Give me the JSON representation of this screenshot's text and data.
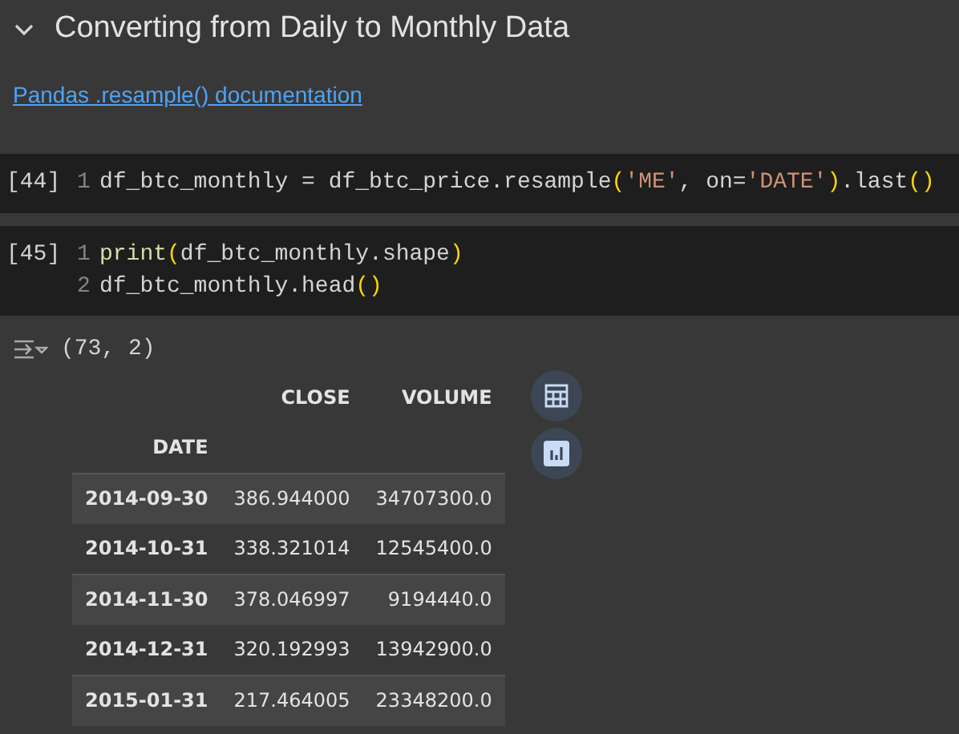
{
  "section": {
    "title": "Converting from Daily to Monthly Data",
    "expanded": true
  },
  "link": "Pandas .resample() documentation",
  "cells": [
    {
      "count": "[44]",
      "lines": [
        {
          "number": "1",
          "tokens": [
            {
              "kind": "plain",
              "text": "df_btc_monthly = df_btc_price.resample"
            },
            {
              "kind": "bracket",
              "text": "("
            },
            {
              "kind": "string",
              "text": "'ME'"
            },
            {
              "kind": "plain",
              "text": ", on="
            },
            {
              "kind": "string",
              "text": "'DATE'"
            },
            {
              "kind": "bracket",
              "text": ")"
            },
            {
              "kind": "plain",
              "text": ".last"
            },
            {
              "kind": "bracket",
              "text": "()"
            }
          ]
        }
      ]
    },
    {
      "count": "[45]",
      "lines": [
        {
          "number": "1",
          "tokens": [
            {
              "kind": "builtin",
              "text": "print"
            },
            {
              "kind": "bracket",
              "text": "("
            },
            {
              "kind": "plain",
              "text": "df_btc_monthly.shape"
            },
            {
              "kind": "bracket",
              "text": ")"
            }
          ]
        },
        {
          "number": "2",
          "tokens": [
            {
              "kind": "plain",
              "text": "df_btc_monthly.head"
            },
            {
              "kind": "bracket",
              "text": "()"
            }
          ]
        }
      ]
    }
  ],
  "output": {
    "shape": "(73, 2)",
    "table": {
      "columns": [
        "",
        "CLOSE",
        "VOLUME"
      ],
      "index_name": "DATE",
      "rows": [
        [
          "2014-09-30",
          "386.944000",
          "34707300.0"
        ],
        [
          "2014-10-31",
          "338.321014",
          "12545400.0"
        ],
        [
          "2014-11-30",
          "378.046997",
          "9194440.0"
        ],
        [
          "2014-12-31",
          "320.192993",
          "13942900.0"
        ],
        [
          "2015-01-31",
          "217.464005",
          "23348200.0"
        ]
      ]
    }
  }
}
